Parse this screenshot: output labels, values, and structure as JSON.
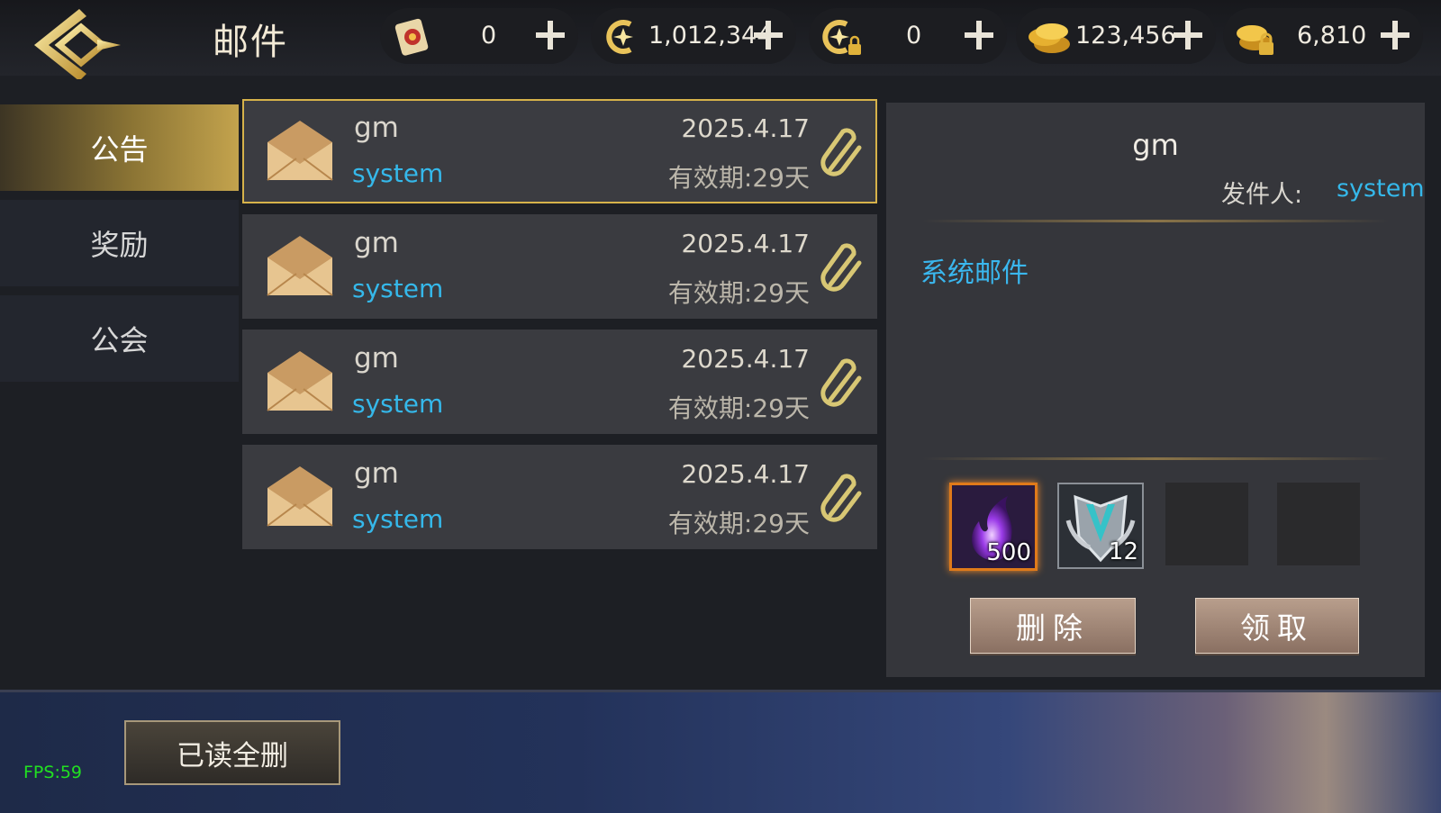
{
  "header": {
    "title": "邮件",
    "resources": [
      {
        "icon": "scroll-icon",
        "value": "0"
      },
      {
        "icon": "star-coin-icon",
        "value": "1,012,344"
      },
      {
        "icon": "locked-star-coin-icon",
        "value": "0"
      },
      {
        "icon": "gold-coins-icon",
        "value": "123,456"
      },
      {
        "icon": "locked-gold-coins-icon",
        "value": "6,810"
      }
    ]
  },
  "tabs": [
    {
      "label": "公告",
      "active": true
    },
    {
      "label": "奖励",
      "active": false
    },
    {
      "label": "公会",
      "active": false
    }
  ],
  "mails": [
    {
      "subject": "gm",
      "sender": "system",
      "date": "2025.4.17",
      "expiry": "有效期:29天",
      "selected": true
    },
    {
      "subject": "gm",
      "sender": "system",
      "date": "2025.4.17",
      "expiry": "有效期:29天",
      "selected": false
    },
    {
      "subject": "gm",
      "sender": "system",
      "date": "2025.4.17",
      "expiry": "有效期:29天",
      "selected": false
    },
    {
      "subject": "gm",
      "sender": "system",
      "date": "2025.4.17",
      "expiry": "有效期:29天",
      "selected": false
    }
  ],
  "detail": {
    "title": "gm",
    "sender_label": "发件人:",
    "sender": "system",
    "body": "系统邮件",
    "attachments": [
      {
        "icon": "purple-flame-icon",
        "count": "500"
      },
      {
        "icon": "shield-badge-icon",
        "count": "12"
      },
      {
        "icon": "",
        "count": ""
      },
      {
        "icon": "",
        "count": ""
      }
    ],
    "delete_label": "删除",
    "claim_label": "领取"
  },
  "footer": {
    "delete_read_label": "已读全删",
    "fps": "FPS:59"
  },
  "colors": {
    "accent_gold": "#c3a34d",
    "link_blue": "#35b8ea",
    "fps_green": "#21e021"
  }
}
